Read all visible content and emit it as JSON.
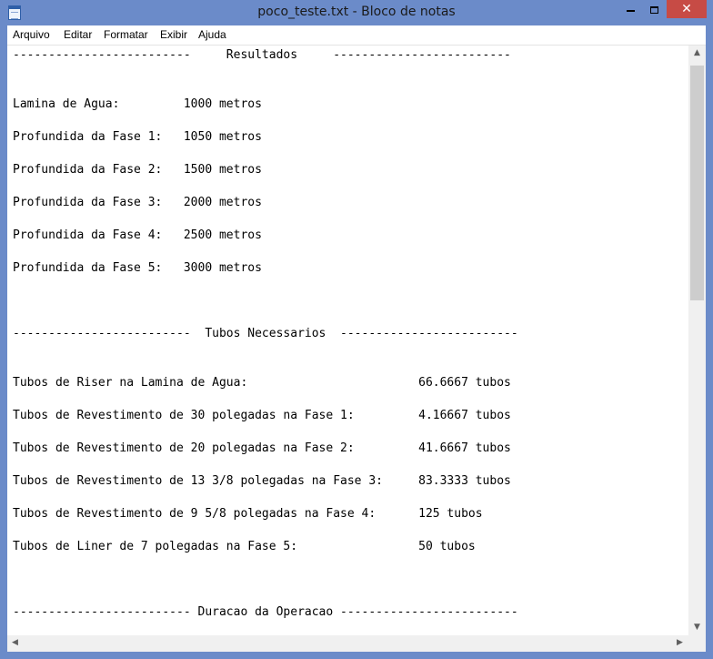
{
  "window": {
    "title": "poco_teste.txt - Bloco de notas",
    "close_glyph": "✕"
  },
  "menu": [
    "Arquivo",
    "Editar",
    "Formatar",
    "Exibir",
    "Ajuda"
  ],
  "document": {
    "lines": [
      "-------------------------     Resultados     -------------------------",
      "",
      "",
      "Lamina de Agua:         1000 metros",
      "",
      "Profundida da Fase 1:   1050 metros",
      "",
      "Profundida da Fase 2:   1500 metros",
      "",
      "Profundida da Fase 3:   2000 metros",
      "",
      "Profundida da Fase 4:   2500 metros",
      "",
      "Profundida da Fase 5:   3000 metros",
      "",
      "",
      "",
      "-------------------------  Tubos Necessarios  -------------------------",
      "",
      "",
      "Tubos de Riser na Lamina de Agua:                        66.6667 tubos",
      "",
      "Tubos de Revestimento de 30 polegadas na Fase 1:         4.16667 tubos",
      "",
      "Tubos de Revestimento de 20 polegadas na Fase 2:         41.6667 tubos",
      "",
      "Tubos de Revestimento de 13 3/8 polegadas na Fase 3:     83.3333 tubos",
      "",
      "Tubos de Revestimento de 9 5/8 polegadas na Fase 4:      125 tubos",
      "",
      "Tubos de Liner de 7 polegadas na Fase 5:                 50 tubos",
      "",
      "",
      "",
      "------------------------- Duracao da Operacao -------------------------"
    ]
  },
  "scrollbar": {
    "up_glyph": "▲",
    "down_glyph": "▼",
    "left_glyph": "◀",
    "right_glyph": "▶"
  }
}
